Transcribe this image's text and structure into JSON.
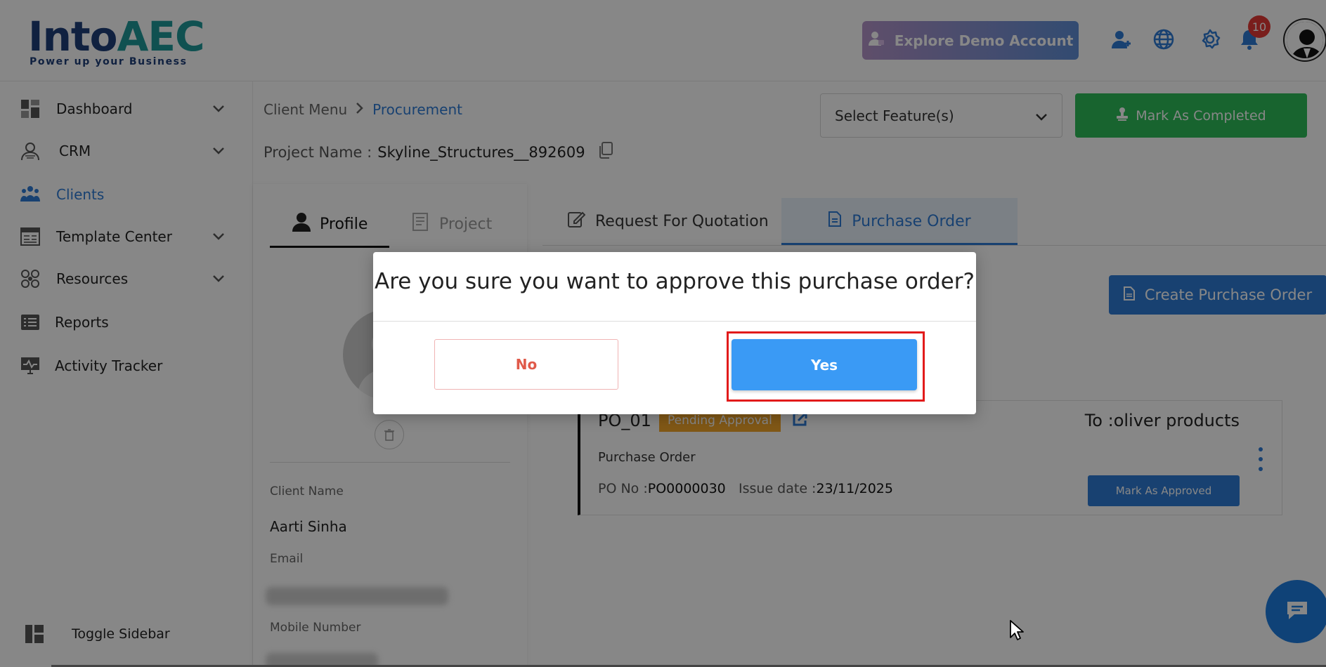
{
  "header": {
    "logo_main": "Into",
    "logo_accent": "AEC",
    "logo_tagline": "Power up your Business",
    "demo_button": "Explore Demo Account",
    "notification_count": "10",
    "icons": [
      "add-user-icon",
      "globe-icon",
      "gear-icon",
      "bell-icon"
    ]
  },
  "sidebar": {
    "items": [
      {
        "label": "Dashboard",
        "icon": "dashboard-icon",
        "has_chevron": true
      },
      {
        "label": "CRM",
        "icon": "crm-icon",
        "has_chevron": true
      },
      {
        "label": "Clients",
        "icon": "clients-icon",
        "active": true
      },
      {
        "label": "Template Center",
        "icon": "template-icon",
        "has_chevron": true
      },
      {
        "label": "Resources",
        "icon": "resources-icon",
        "has_chevron": true
      },
      {
        "label": "Reports",
        "icon": "reports-icon"
      },
      {
        "label": "Activity Tracker",
        "icon": "activity-icon"
      }
    ],
    "toggle_label": "Toggle Sidebar"
  },
  "breadcrumb": {
    "root": "Client Menu",
    "current": "Procurement"
  },
  "project": {
    "label": "Project Name :",
    "value": "Skyline_Structures__892609"
  },
  "toolbar": {
    "select_feature_placeholder": "Select Feature(s)",
    "mark_completed": "Mark As Completed"
  },
  "profile_panel": {
    "tabs": [
      "Profile",
      "Project"
    ],
    "active_tab": "Profile",
    "fields": [
      {
        "label": "Client Name",
        "value": "Aarti Sinha"
      },
      {
        "label": "Email",
        "value": ""
      },
      {
        "label": "Mobile Number",
        "value": ""
      }
    ]
  },
  "procurement": {
    "tabs": [
      "Request For Quotation",
      "Purchase Order"
    ],
    "active_tab": "Purchase Order",
    "create_button": "Create Purchase Order",
    "purchase_order": {
      "id": "PO_01",
      "status": "Pending Approval",
      "to": "To :oliver products",
      "type": "Purchase Order",
      "po_no_label": "PO No :",
      "po_no": "PO0000030",
      "issue_label": "Issue date :",
      "issue_date": "23/11/2025",
      "approve_button": "Mark As Approved"
    }
  },
  "modal": {
    "title": "Are you sure you want to approve this purchase order?",
    "no_label": "No",
    "yes_label": "Yes"
  },
  "colors": {
    "accent": "#2f7cd6",
    "success": "#2ebd59",
    "warning": "#f4a72a",
    "danger": "#e05a4a",
    "yes_button": "#3a9af5",
    "highlight": "#e21b1b"
  }
}
